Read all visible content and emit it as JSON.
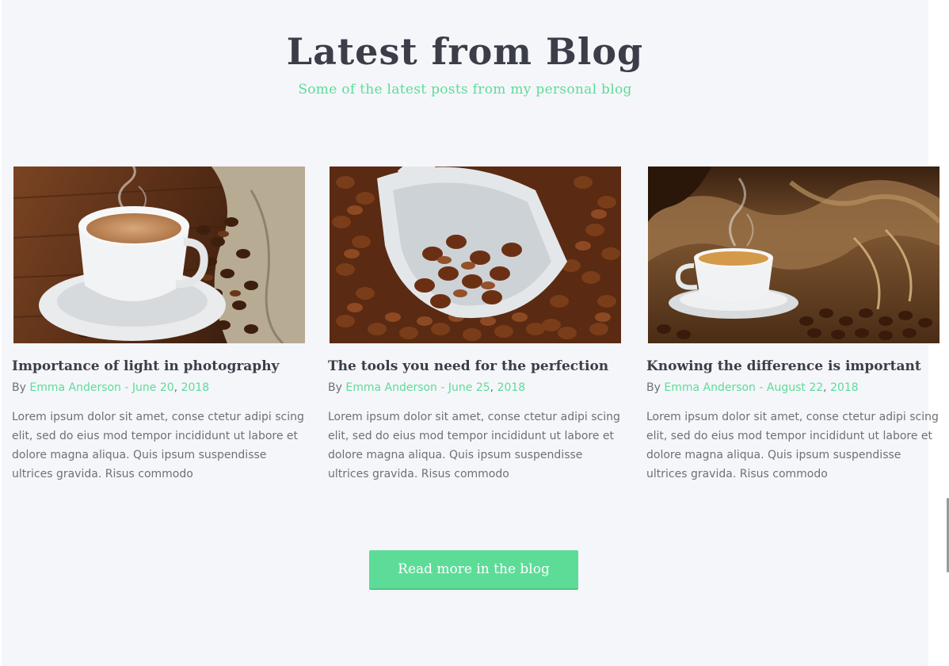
{
  "section": {
    "title": "Latest from Blog",
    "subtitle": "Some of the latest posts from my personal blog"
  },
  "posts": [
    {
      "title": "Importance of light in photography",
      "by": "By",
      "author": "Emma Anderson",
      "separator": "-",
      "date_day": "June 20",
      "date_comma": ",",
      "date_year": "2018",
      "excerpt": "Lorem ipsum dolor sit amet, conse ctetur adipi scing elit, sed do eius mod tempor incididunt ut labore et dolore magna aliqua. Quis ipsum suspendisse ultrices gravida. Risus commodo"
    },
    {
      "title": "The tools you need for the perfection",
      "by": "By",
      "author": "Emma Anderson",
      "separator": "-",
      "date_day": "June 25",
      "date_comma": ",",
      "date_year": "2018",
      "excerpt": "Lorem ipsum dolor sit amet, conse ctetur adipi scing elit, sed do eius mod tempor incididunt ut labore et dolore magna aliqua. Quis ipsum suspendisse ultrices gravida. Risus commodo"
    },
    {
      "title": "Knowing the difference is important",
      "by": "By",
      "author": "Emma Anderson",
      "separator": "-",
      "date_day": "August 22",
      "date_comma": ",",
      "date_year": "2018",
      "excerpt": "Lorem ipsum dolor sit amet, conse ctetur adipi scing elit, sed do eius mod tempor incididunt ut labore et dolore magna aliqua. Quis ipsum suspendisse ultrices gravida. Risus commodo"
    }
  ],
  "cta": {
    "label": "Read more in the blog"
  },
  "colors": {
    "accent": "#5ddc98",
    "heading": "#3b3e48",
    "body_text": "#6e7078",
    "background": "#f5f6fa"
  },
  "images": [
    {
      "icon": "coffee-cup-with-beans-photo"
    },
    {
      "icon": "tipped-cup-of-coffee-beans-photo"
    },
    {
      "icon": "coffee-cup-on-burlap-photo"
    }
  ]
}
